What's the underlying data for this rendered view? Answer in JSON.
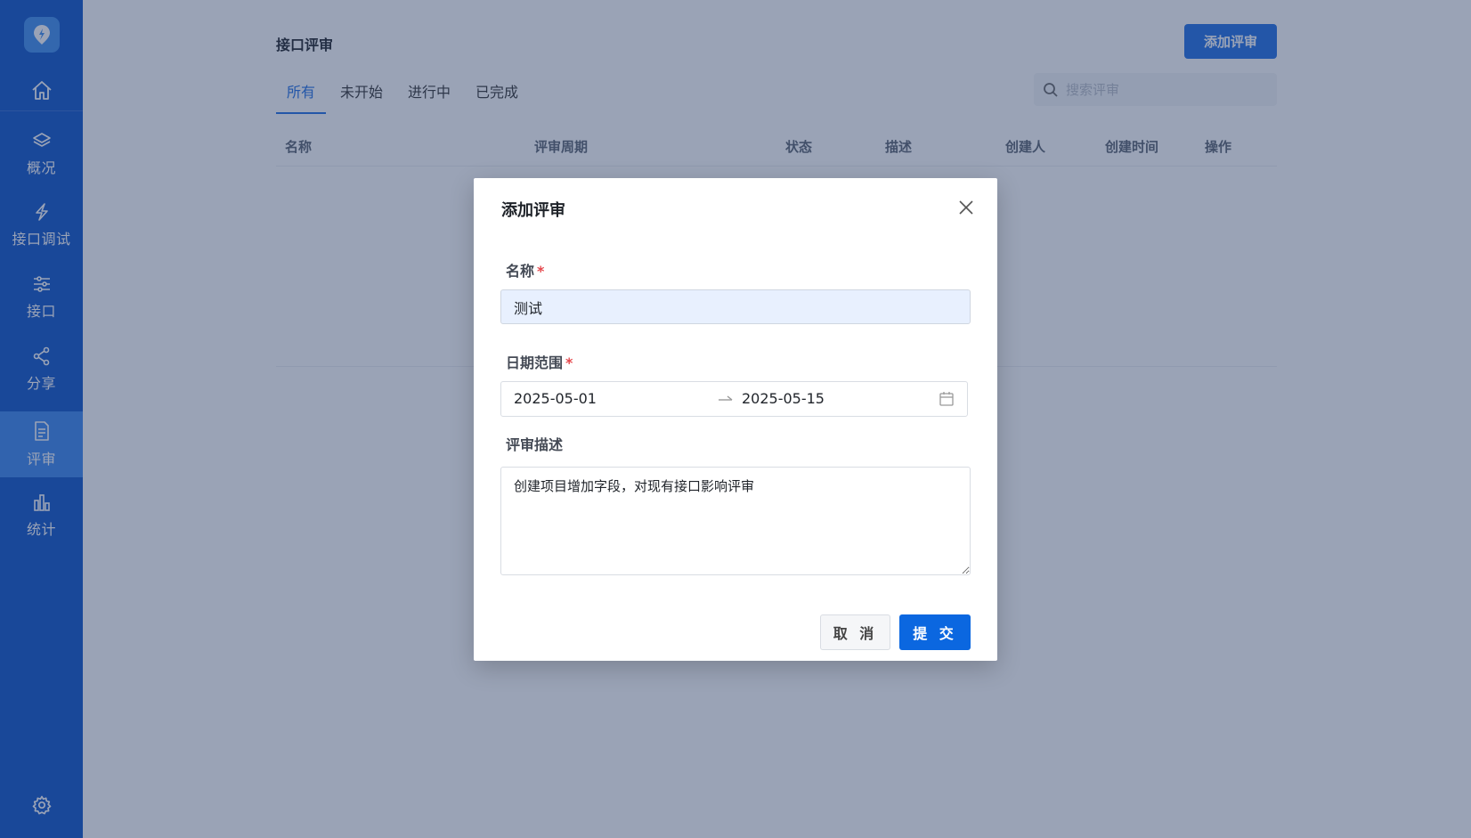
{
  "sidebar": {
    "logo_icon": "rocket-logo-icon",
    "items": [
      {
        "name": "home",
        "label": "",
        "icon": "home-icon"
      },
      {
        "name": "overview",
        "label": "概况",
        "icon": "layers-icon"
      },
      {
        "name": "api-debug",
        "label": "接口调试",
        "icon": "lightning-icon"
      },
      {
        "name": "api",
        "label": "接口",
        "icon": "sliders-icon"
      },
      {
        "name": "share",
        "label": "分享",
        "icon": "share-icon"
      },
      {
        "name": "review",
        "label": "评审",
        "icon": "document-icon",
        "active": true
      },
      {
        "name": "stats",
        "label": "统计",
        "icon": "bar-chart-icon"
      }
    ],
    "settings_icon": "gear-icon"
  },
  "main": {
    "title": "接口评审",
    "add_button": "添加评审",
    "tabs": [
      {
        "label": "所有",
        "active": true
      },
      {
        "label": "未开始"
      },
      {
        "label": "进行中"
      },
      {
        "label": "已完成"
      }
    ],
    "search": {
      "placeholder": "搜索评审"
    },
    "table_headers": [
      "名称",
      "评审周期",
      "状态",
      "描述",
      "创建人",
      "创建时间",
      "操作"
    ]
  },
  "modal": {
    "title": "添加评审",
    "name_label": "名称",
    "name_value": "测试",
    "date_label": "日期范围",
    "date_start": "2025-05-01",
    "date_end": "2025-05-15",
    "desc_label": "评审描述",
    "desc_value": "创建项目增加字段，对现有接口影响评审",
    "required_mark": "*",
    "cancel_button": "取 消",
    "submit_button": "提 交"
  },
  "colors": {
    "sidebar_bg": "#0c53c9",
    "sidebar_active": "#3a86f0",
    "primary": "#1f6fe5",
    "required": "#e5484d"
  }
}
